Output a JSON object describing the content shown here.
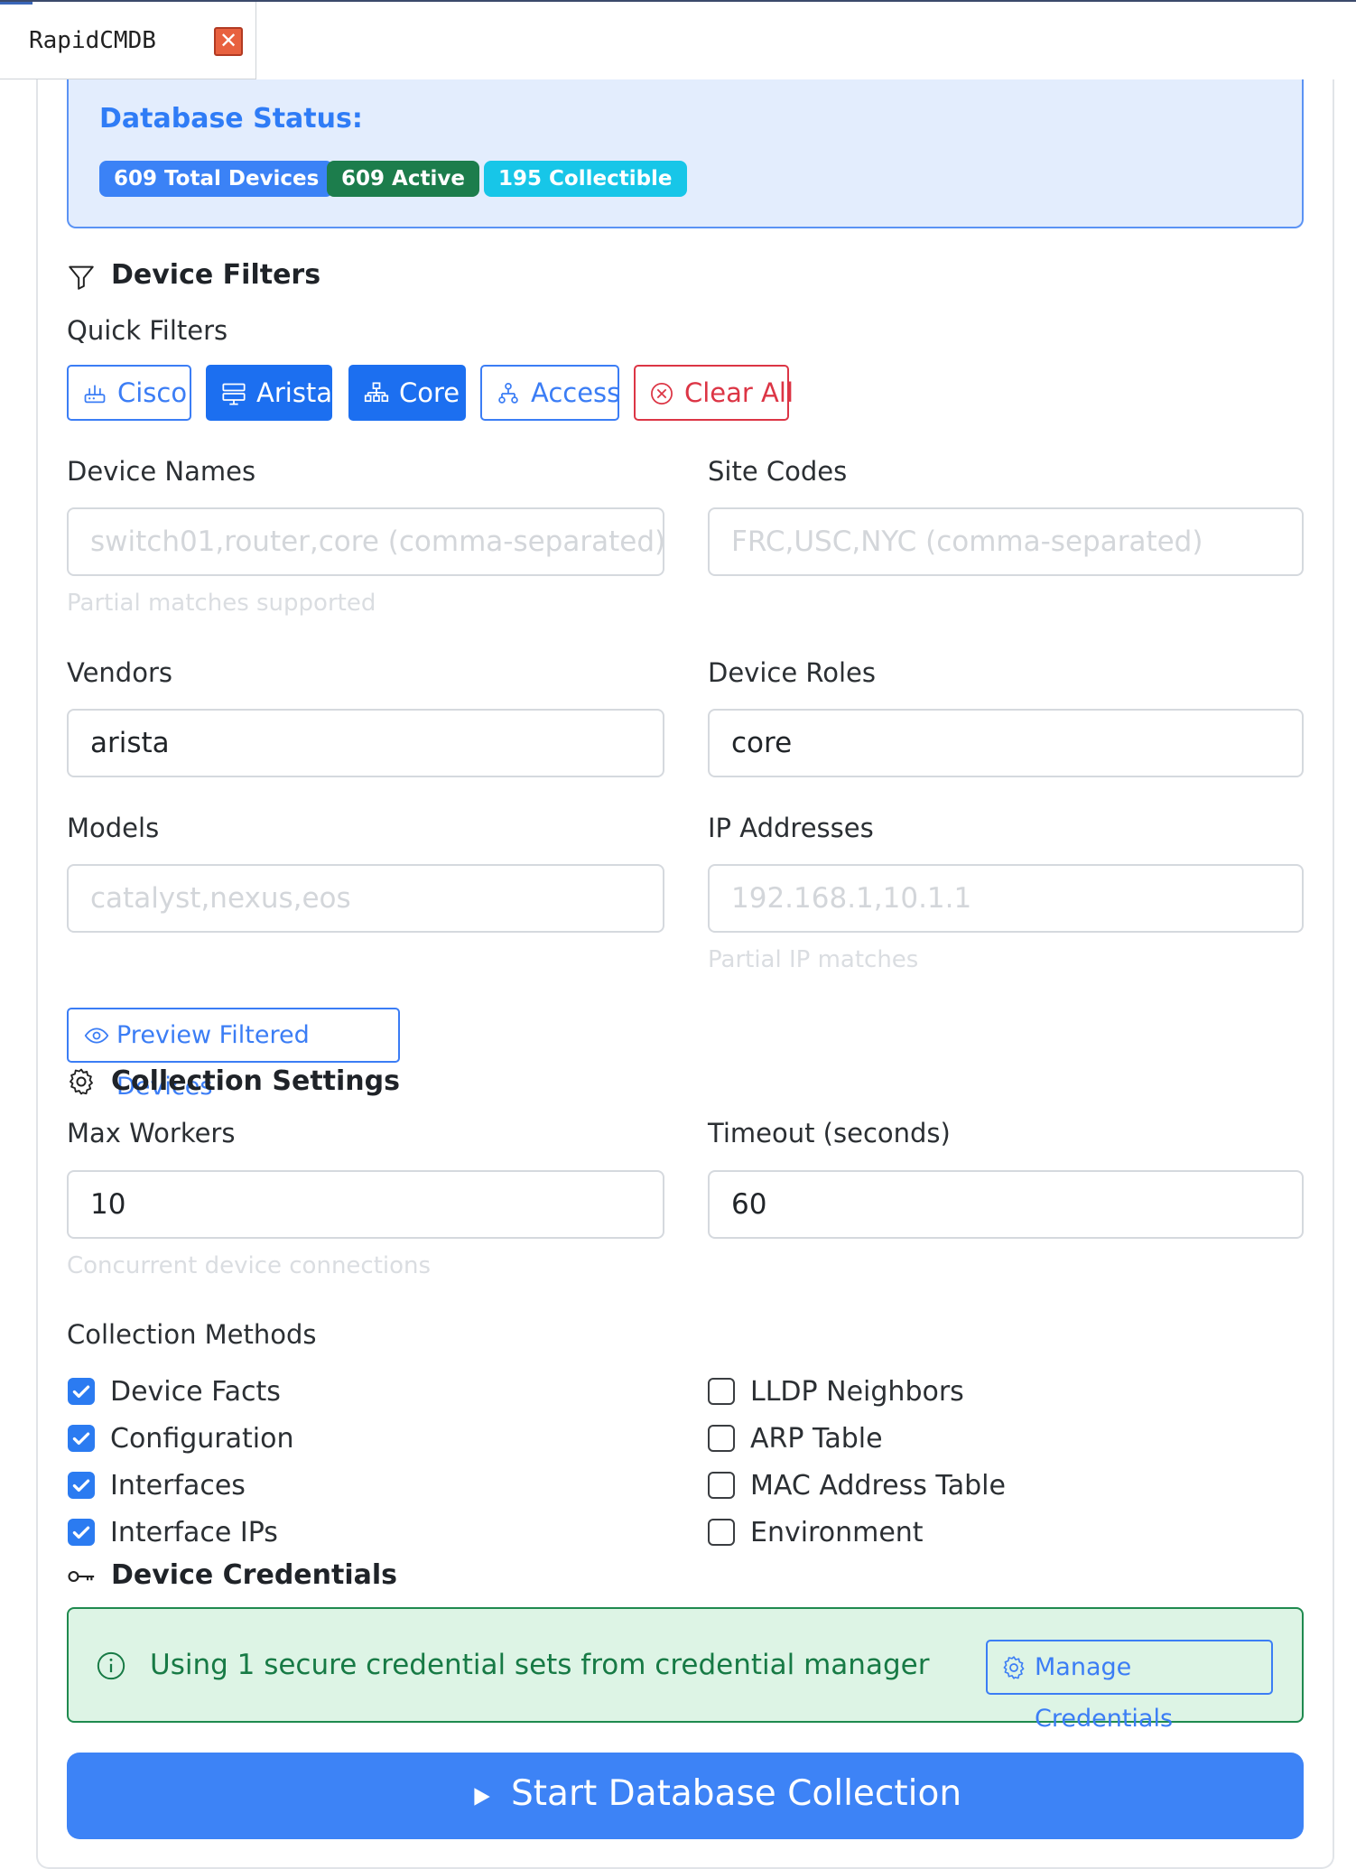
{
  "tab": {
    "title": "RapidCMDB",
    "close_glyph": "✕"
  },
  "status": {
    "title": "Database Status:",
    "badges": [
      "609 Total Devices",
      "609 Active",
      "195 Collectible"
    ]
  },
  "filters": {
    "heading": "Device Filters",
    "quick_label": "Quick Filters",
    "quick": [
      {
        "label": "Cisco",
        "icon": "router-icon",
        "active": false
      },
      {
        "label": "Arista",
        "icon": "switch-icon",
        "active": true
      },
      {
        "label": "Core",
        "icon": "hierarchy-icon",
        "active": true
      },
      {
        "label": "Access",
        "icon": "access-diagram-icon",
        "active": false
      }
    ],
    "clear_label": "Clear All",
    "device_names": {
      "label": "Device Names",
      "placeholder": "switch01,router,core (comma-separated)",
      "value": "",
      "help": "Partial matches supported"
    },
    "site_codes": {
      "label": "Site Codes",
      "placeholder": "FRC,USC,NYC (comma-separated)",
      "value": ""
    },
    "vendors": {
      "label": "Vendors",
      "value": "arista"
    },
    "roles": {
      "label": "Device Roles",
      "value": "core"
    },
    "models": {
      "label": "Models",
      "placeholder": "catalyst,nexus,eos",
      "value": ""
    },
    "ips": {
      "label": "IP Addresses",
      "placeholder": "192.168.1,10.1.1",
      "value": "",
      "help": "Partial IP matches"
    },
    "preview_label": "Preview Filtered Devices"
  },
  "settings": {
    "heading": "Collection Settings",
    "max_workers": {
      "label": "Max Workers",
      "value": "10",
      "help": "Concurrent device connections"
    },
    "timeout": {
      "label": "Timeout (seconds)",
      "value": "60"
    },
    "methods_label": "Collection Methods",
    "methods": [
      {
        "label": "Device Facts",
        "checked": true
      },
      {
        "label": "Configuration",
        "checked": true
      },
      {
        "label": "Interfaces",
        "checked": true
      },
      {
        "label": "Interface IPs",
        "checked": true
      },
      {
        "label": "LLDP Neighbors",
        "checked": false
      },
      {
        "label": "ARP Table",
        "checked": false
      },
      {
        "label": "MAC Address Table",
        "checked": false
      },
      {
        "label": "Environment",
        "checked": false
      }
    ]
  },
  "credentials": {
    "heading": "Device Credentials",
    "info": "Using 1 secure credential sets from credential manager",
    "manage_label": "Manage Credentials"
  },
  "start_label": "Start Database Collection",
  "colors": {
    "primary": "#3b7df5",
    "success": "#1c7d4c",
    "info": "#17c6e8",
    "danger": "#dc3545"
  }
}
